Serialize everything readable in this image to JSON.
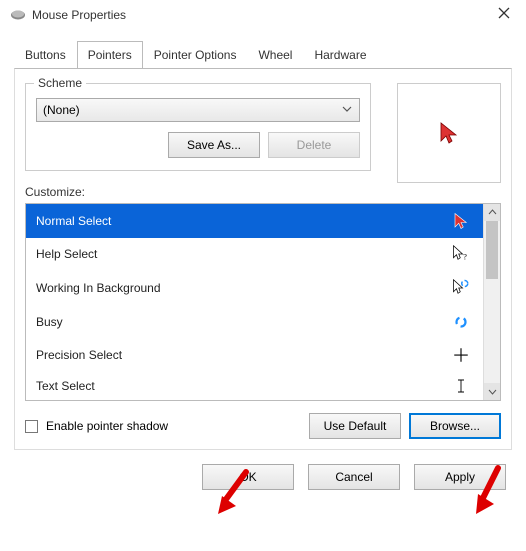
{
  "window": {
    "title": "Mouse Properties"
  },
  "tabs": {
    "items": [
      "Buttons",
      "Pointers",
      "Pointer Options",
      "Wheel",
      "Hardware"
    ],
    "active": 1
  },
  "scheme": {
    "legend": "Scheme",
    "selected": "(None)",
    "save_label": "Save As...",
    "delete_label": "Delete"
  },
  "customize": {
    "label": "Customize:",
    "items": [
      {
        "label": "Normal Select",
        "icon": "cursor-red",
        "selected": true
      },
      {
        "label": "Help Select",
        "icon": "cursor-help",
        "selected": false
      },
      {
        "label": "Working In Background",
        "icon": "cursor-busybg",
        "selected": false
      },
      {
        "label": "Busy",
        "icon": "busy-circle",
        "selected": false
      },
      {
        "label": "Precision Select",
        "icon": "crosshair",
        "selected": false
      },
      {
        "label": "Text Select",
        "icon": "ibeam",
        "selected": false
      }
    ]
  },
  "shadow": {
    "label": "Enable pointer shadow",
    "checked": false
  },
  "buttons": {
    "use_default": "Use Default",
    "browse": "Browse...",
    "ok": "OK",
    "cancel": "Cancel",
    "apply": "Apply"
  },
  "icons": {
    "preview": "cursor-red"
  }
}
